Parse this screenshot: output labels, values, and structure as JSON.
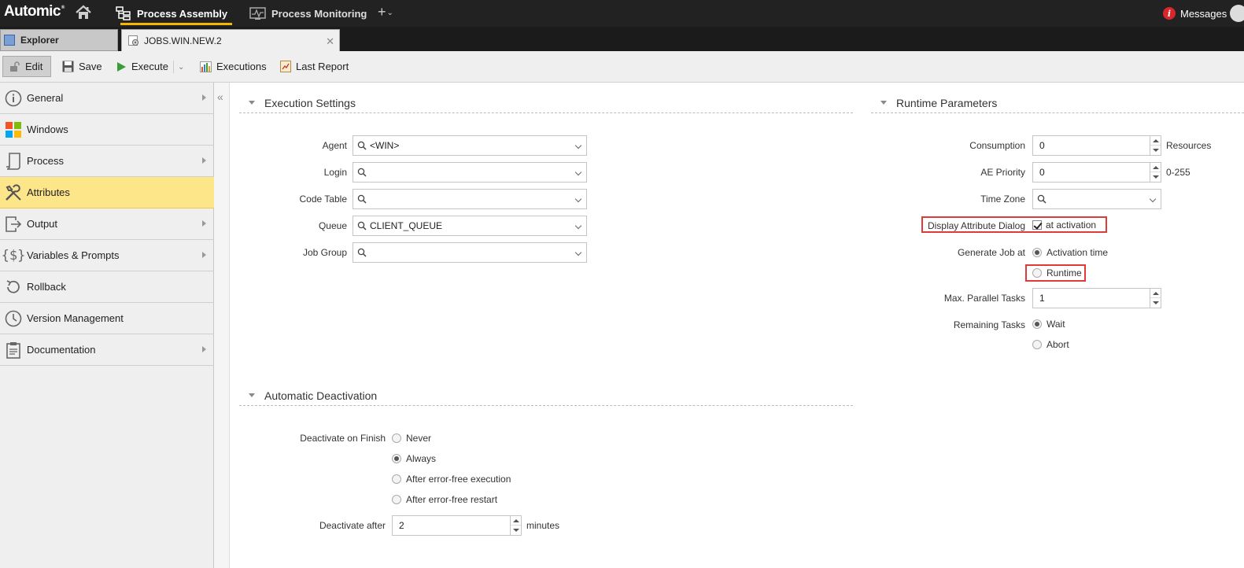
{
  "app": {
    "logo": "Automic"
  },
  "nav": {
    "process_assembly": "Process Assembly",
    "process_monitoring": "Process Monitoring",
    "plus": "+",
    "messages": "Messages",
    "messages_badge": "i"
  },
  "tabs": {
    "explorer": "Explorer",
    "job": "JOBS.WIN.NEW.2"
  },
  "toolbar": {
    "edit": "Edit",
    "save": "Save",
    "execute": "Execute",
    "executions": "Executions",
    "last_report": "Last Report"
  },
  "sidebar": {
    "items": [
      {
        "label": "General",
        "icon": "info-icon",
        "has_arrow": true
      },
      {
        "label": "Windows",
        "icon": "windows-icon",
        "has_arrow": false
      },
      {
        "label": "Process",
        "icon": "script-icon",
        "has_arrow": true
      },
      {
        "label": "Attributes",
        "icon": "tools-icon",
        "has_arrow": false,
        "active": true
      },
      {
        "label": "Output",
        "icon": "output-icon",
        "has_arrow": true
      },
      {
        "label": "Variables & Prompts",
        "icon": "variables-icon",
        "has_arrow": true
      },
      {
        "label": "Rollback",
        "icon": "rollback-icon",
        "has_arrow": false
      },
      {
        "label": "Version Management",
        "icon": "clock-icon",
        "has_arrow": false
      },
      {
        "label": "Documentation",
        "icon": "clipboard-icon",
        "has_arrow": true
      }
    ]
  },
  "execution_settings": {
    "title": "Execution Settings",
    "agent": {
      "label": "Agent",
      "value": "<WIN>"
    },
    "login": {
      "label": "Login",
      "value": ""
    },
    "code_table": {
      "label": "Code Table",
      "value": ""
    },
    "queue": {
      "label": "Queue",
      "value": "CLIENT_QUEUE"
    },
    "job_group": {
      "label": "Job Group",
      "value": ""
    }
  },
  "runtime_parameters": {
    "title": "Runtime Parameters",
    "consumption": {
      "label": "Consumption",
      "value": "0",
      "unit": "Resources"
    },
    "ae_priority": {
      "label": "AE Priority",
      "value": "0",
      "unit": "0-255"
    },
    "time_zone": {
      "label": "Time Zone",
      "value": ""
    },
    "display_attribute_dialog": {
      "label": "Display Attribute Dialog",
      "checkbox_label": "at activation",
      "checked": true
    },
    "generate_job_at": {
      "label": "Generate Job at",
      "options": [
        "Activation time",
        "Runtime"
      ],
      "selected": "Activation time"
    },
    "max_parallel_tasks": {
      "label": "Max. Parallel Tasks",
      "value": "1"
    },
    "remaining_tasks": {
      "label": "Remaining Tasks",
      "options": [
        "Wait",
        "Abort"
      ],
      "selected": "Wait"
    }
  },
  "automatic_deactivation": {
    "title": "Automatic Deactivation",
    "deactivate_on_finish": {
      "label": "Deactivate on Finish",
      "options": [
        "Never",
        "Always",
        "After error-free execution",
        "After error-free restart"
      ],
      "selected": "Always"
    },
    "deactivate_after": {
      "label": "Deactivate after",
      "value": "2",
      "unit": "minutes"
    }
  },
  "colors": {
    "accent": "#f5b800",
    "active_sidebar": "#fde58a",
    "highlight_box": "#e03b3b",
    "topbar": "#222222"
  }
}
